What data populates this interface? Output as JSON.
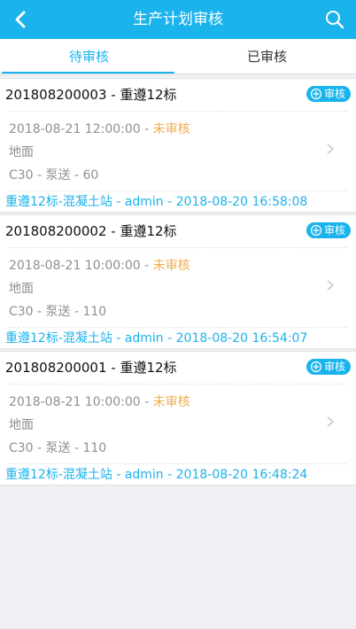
{
  "header": {
    "title": "生产计划审核"
  },
  "tabs": [
    {
      "label": "待审核",
      "active": true
    },
    {
      "label": "已审核",
      "active": false
    }
  ],
  "items": [
    {
      "title": "201808200003 - 重遵12标",
      "badge": "审核",
      "time": "2018-08-21 12:00:00 - ",
      "status": "未审核",
      "location": "地面",
      "spec": "C30 - 泵送 - 60",
      "footer": "重遵12标-混凝土站 - admin - 2018-08-20 16:58:08"
    },
    {
      "title": "201808200002 - 重遵12标",
      "badge": "审核",
      "time": "2018-08-21 10:00:00 - ",
      "status": "未审核",
      "location": "地面",
      "spec": "C30 - 泵送 - 110",
      "footer": "重遵12标-混凝土站 - admin - 2018-08-20 16:54:07"
    },
    {
      "title": "201808200001 - 重遵12标",
      "badge": "审核",
      "time": "2018-08-21 10:00:00 - ",
      "status": "未审核",
      "location": "地面",
      "spec": "C30 - 泵送 - 110",
      "footer": "重遵12标-混凝土站 - admin - 2018-08-20 16:48:24"
    }
  ],
  "colors": {
    "primary": "#1ab3ec",
    "status": "#f0ad4e",
    "background": "#efeff4"
  },
  "icons": {
    "back": "back-arrow-icon",
    "search": "search-icon",
    "badge": "plus-circle-icon",
    "chevron": "chevron-right-icon"
  }
}
